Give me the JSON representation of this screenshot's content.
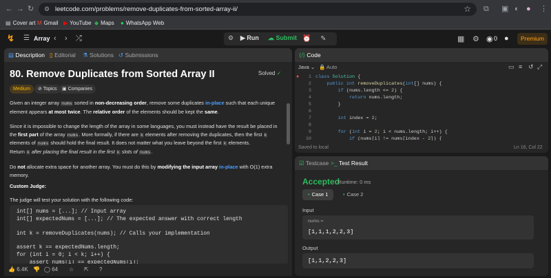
{
  "browser": {
    "url": "leetcode.com/problems/remove-duplicates-from-sorted-array-ii/",
    "bookmarks": [
      {
        "label": "Cover art",
        "icon": "folder-icon"
      },
      {
        "label": "Gmail",
        "icon": "gmail-icon"
      },
      {
        "label": "YouTube",
        "icon": "youtube-icon"
      },
      {
        "label": "Maps",
        "icon": "maps-icon"
      },
      {
        "label": "WhatsApp Web",
        "icon": "whatsapp-icon"
      }
    ]
  },
  "toolbar": {
    "list_label": "Array",
    "run_label": "Run",
    "submit_label": "Submit",
    "coins": "0",
    "premium_label": "Premium"
  },
  "left": {
    "tabs": [
      "Description",
      "Editorial",
      "Solutions",
      "Submissions"
    ],
    "title": "80. Remove Duplicates from Sorted Array II",
    "solved_label": "Solved",
    "tags": [
      "Medium",
      "Topics",
      "Companies"
    ],
    "p1": {
      "a": "Given an integer array ",
      "code1": "nums",
      "b": " sorted in ",
      "bold1": "non-decreasing order",
      "c": ", remove some duplicates ",
      "link1": "in-place",
      "d": " such that each unique element appears ",
      "bold2": "at most twice",
      "e": ". The ",
      "bold3": "relative order",
      "f": " of the elements should be kept the ",
      "bold4": "same",
      "g": "."
    },
    "p2": {
      "a": "Since it is impossible to change the length of the array in some languages, you must instead have the result be placed in the ",
      "bold1": "first part",
      "b": " of the array ",
      "code1": "nums",
      "c": ". More formally, if there are ",
      "code2": "k",
      "d": " elements after removing the duplicates, then the first ",
      "code3": "k",
      "e": " elements of ",
      "code4": "nums",
      "f": " should hold the final result. It does not matter what you leave beyond the first ",
      "code5": "k",
      "g": " elements."
    },
    "p3": {
      "a": "Return ",
      "code1": "k",
      "b": " after placing the final result in the first ",
      "code2": "k",
      "c": " slots of ",
      "code3": "nums",
      "d": "."
    },
    "p4": {
      "a": "Do ",
      "bold1": "not",
      "b": " allocate extra space for another array. You must do this by ",
      "bold2": "modifying the input array",
      "c": " ",
      "link1": "in-place",
      "d": " with O(1) extra memory."
    },
    "custom_judge_heading": "Custom Judge:",
    "judge_intro": "The judge will test your solution with the following code:",
    "judge_code": [
      "int[] nums = [...]; // Input array",
      "int[] expectedNums = [...]; // The expected answer with correct length",
      "",
      "int k = removeDuplicates(nums); // Calls your implementation",
      "",
      "assert k == expectedNums.length;",
      "for (int i = 0; i < k; i++) {",
      "    assert nums[i] == expectedNums[i];"
    ],
    "likes": "6.4K",
    "comments": "64"
  },
  "editor": {
    "tab_label": "Code",
    "language": "Java",
    "mode": "Auto",
    "line_numbers": [
      "1",
      "2",
      "3",
      "4",
      "5",
      "6",
      "7",
      "8",
      "9",
      "10"
    ],
    "status_left": "Saved to local",
    "status_right": "Ln 16, Col 22"
  },
  "result": {
    "tabs": [
      "Testcase",
      "Test Result"
    ],
    "status": "Accepted",
    "runtime": "Runtime: 0 ms",
    "cases": [
      "Case 1",
      "Case 2"
    ],
    "input_label": "Input",
    "param_name": "nums =",
    "param_value": "[1,1,1,2,2,3]",
    "output_label": "Output",
    "output_value": "[1,1,2,2,3]"
  },
  "colors": {
    "accent": "#ffa116",
    "accepted": "#2cbb5d",
    "link": "#4a9fff",
    "background": "#1a1a1a",
    "panel": "#262626"
  }
}
